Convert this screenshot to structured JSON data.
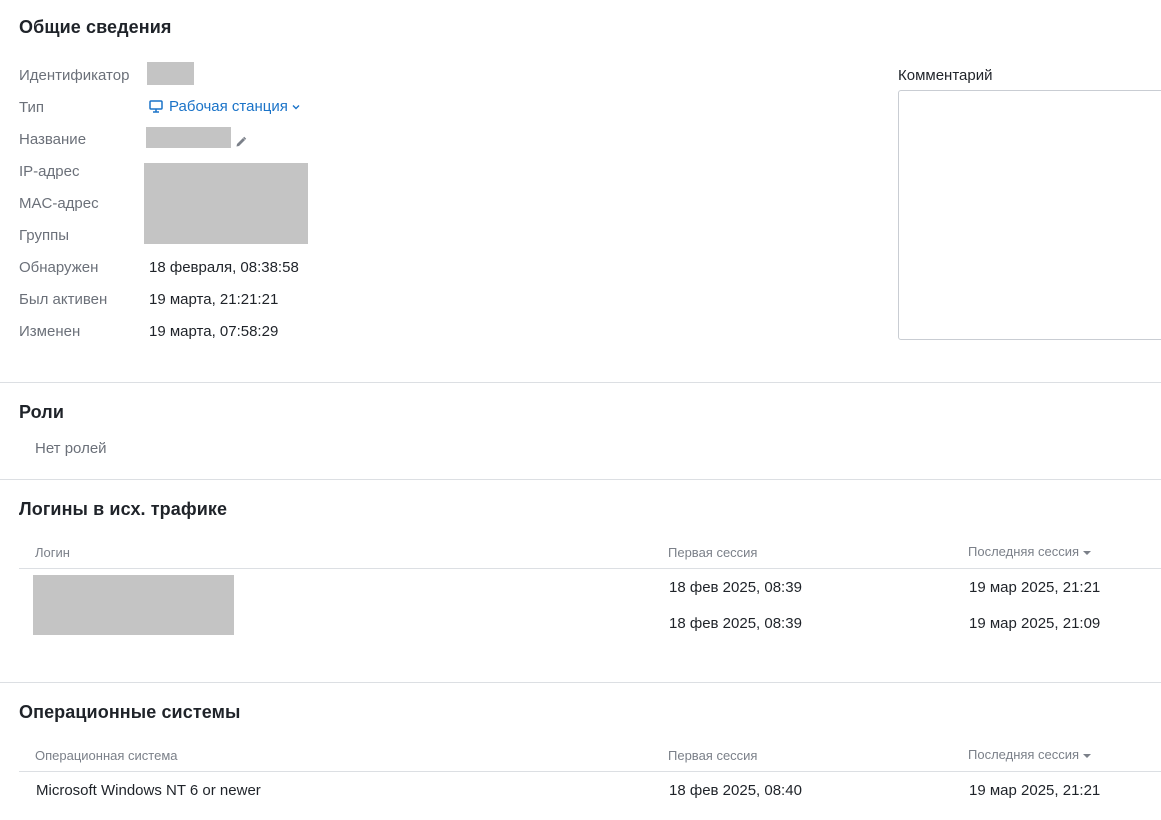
{
  "general": {
    "title": "Общие сведения",
    "labels": {
      "id": "Идентификатор",
      "type": "Тип",
      "name": "Название",
      "ip": "IP-адрес",
      "mac": "MAC-адрес",
      "groups": "Группы",
      "discovered": "Обнаружен",
      "last_active": "Был активен",
      "modified": "Изменен"
    },
    "type_value": "Рабочая станция",
    "discovered_value": "18 февраля, 08:38:58",
    "last_active_value": "19 марта, 21:21:21",
    "modified_value": "19 марта, 07:58:29",
    "comment_label": "Комментарий",
    "comment_value": ""
  },
  "roles": {
    "title": "Роли",
    "empty_text": "Нет ролей"
  },
  "logins": {
    "title": "Логины в исх. трафике",
    "columns": {
      "login": "Логин",
      "first": "Первая сессия",
      "last": "Последняя сессия"
    },
    "rows": [
      {
        "first": "18 фев 2025, 08:39",
        "last": "19 мар 2025, 21:21"
      },
      {
        "first": "18 фев 2025, 08:39",
        "last": "19 мар 2025, 21:09"
      }
    ]
  },
  "os": {
    "title": "Операционные системы",
    "columns": {
      "os": "Операционная система",
      "first": "Первая сессия",
      "last": "Последняя сессия"
    },
    "rows": [
      {
        "name": "Microsoft Windows NT 6 or newer",
        "first": "18 фев 2025, 08:40",
        "last": "19 мар 2025, 21:21"
      }
    ]
  },
  "icons": {
    "type": "monitor-icon",
    "edit": "pencil-icon",
    "dropdown": "chevron-down-icon",
    "sort": "sort-desc-icon"
  },
  "colors": {
    "accent": "#1a73c8",
    "redaction": "#c4c4c4",
    "divider": "#dcdfe3"
  }
}
